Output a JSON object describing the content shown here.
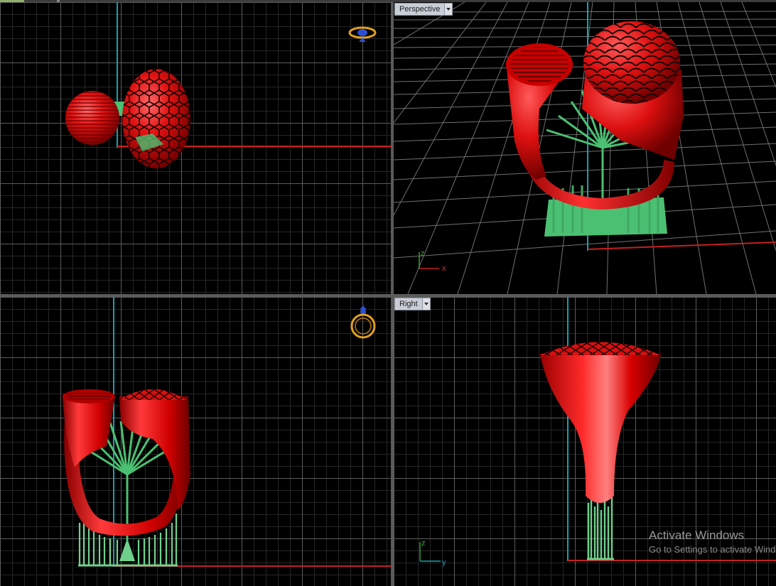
{
  "viewports": {
    "top": {
      "label": ""
    },
    "perspective": {
      "label": "Perspective"
    },
    "front": {
      "label": ""
    },
    "right": {
      "label": "Right"
    }
  },
  "axes": {
    "perspective": {
      "z": "z",
      "x": "x"
    },
    "right": {
      "z": "z",
      "y": "y"
    }
  },
  "watermark": {
    "title": "Activate Windows",
    "subtitle": "Go to Settings to activate Windows."
  },
  "colors": {
    "viewport_bg": "#000000",
    "grid_major": "#5c5c5c",
    "grid_minor": "#262626",
    "x_axis": "#c42020",
    "y_axis": "#1aa0b0",
    "model": "#e01010",
    "supports": "#4cc072",
    "gumball": "#e0a020"
  }
}
